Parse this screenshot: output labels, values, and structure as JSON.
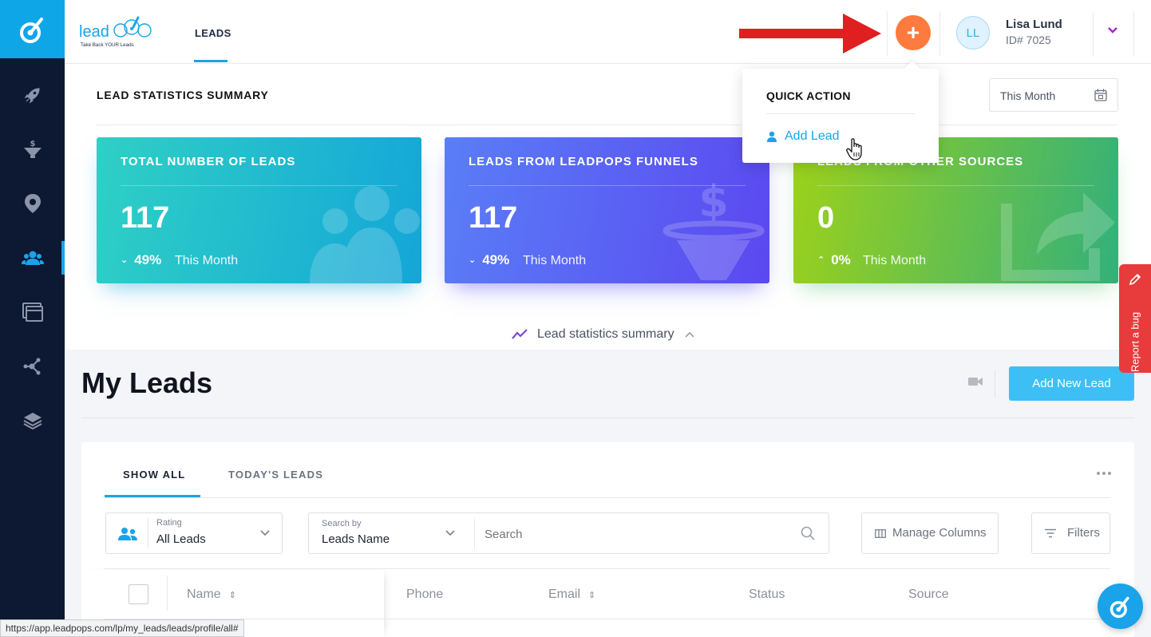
{
  "header": {
    "brand_text": "lead",
    "brand_tagline": "Take Back YOUR Leads",
    "nav_tab": "LEADS",
    "user": {
      "initials": "LL",
      "name": "Lisa Lund",
      "id": "ID# 7025"
    }
  },
  "quick_action": {
    "title": "QUICK ACTION",
    "item_label": "Add Lead"
  },
  "stats": {
    "title": "LEAD STATISTICS SUMMARY",
    "period_select": "This Month",
    "toggle_label": "Lead statistics summary",
    "cards": [
      {
        "title": "TOTAL NUMBER OF LEADS",
        "value": "117",
        "change": "49%",
        "direction": "down",
        "period": "This Month",
        "color_from": "#2fd0c5",
        "color_to": "#14a6d8"
      },
      {
        "title": "LEADS FROM LEADPOPS FUNNELS",
        "value": "117",
        "change": "49%",
        "direction": "down",
        "period": "This Month",
        "color_from": "#5a7ef7",
        "color_to": "#5b48f0"
      },
      {
        "title": "LEADS FROM OTHER SOURCES",
        "value": "0",
        "change": "0%",
        "direction": "up",
        "period": "This Month",
        "color_from": "#9dd11a",
        "color_to": "#33b07b"
      }
    ]
  },
  "report_bug": {
    "label": "Report a bug"
  },
  "leads": {
    "title": "My Leads",
    "add_button": "Add New Lead",
    "tabs": [
      {
        "label": "SHOW ALL",
        "active": true
      },
      {
        "label": "TODAY'S LEADS",
        "active": false
      }
    ],
    "rating": {
      "label": "Rating",
      "value": "All Leads"
    },
    "search_by": {
      "label": "Search by",
      "value": "Leads Name"
    },
    "search_placeholder": "Search",
    "manage_columns": "Manage Columns",
    "filters": "Filters",
    "columns": [
      "Name",
      "Phone",
      "Email",
      "Status",
      "Source"
    ]
  },
  "status_bar_url": "https://app.leadpops.com/lp/my_leads/leads/profile/all#",
  "colors": {
    "accent": "#1aa3e8",
    "sidebar": "#0d1833",
    "plus_button": "#ff7a3d",
    "report_bug": "#e83b3b"
  },
  "icons": {
    "sidebar": [
      "rocket-icon",
      "funnel-dollar-icon",
      "map-pin-icon",
      "users-icon",
      "windows-icon",
      "network-icon",
      "layers-icon"
    ]
  }
}
